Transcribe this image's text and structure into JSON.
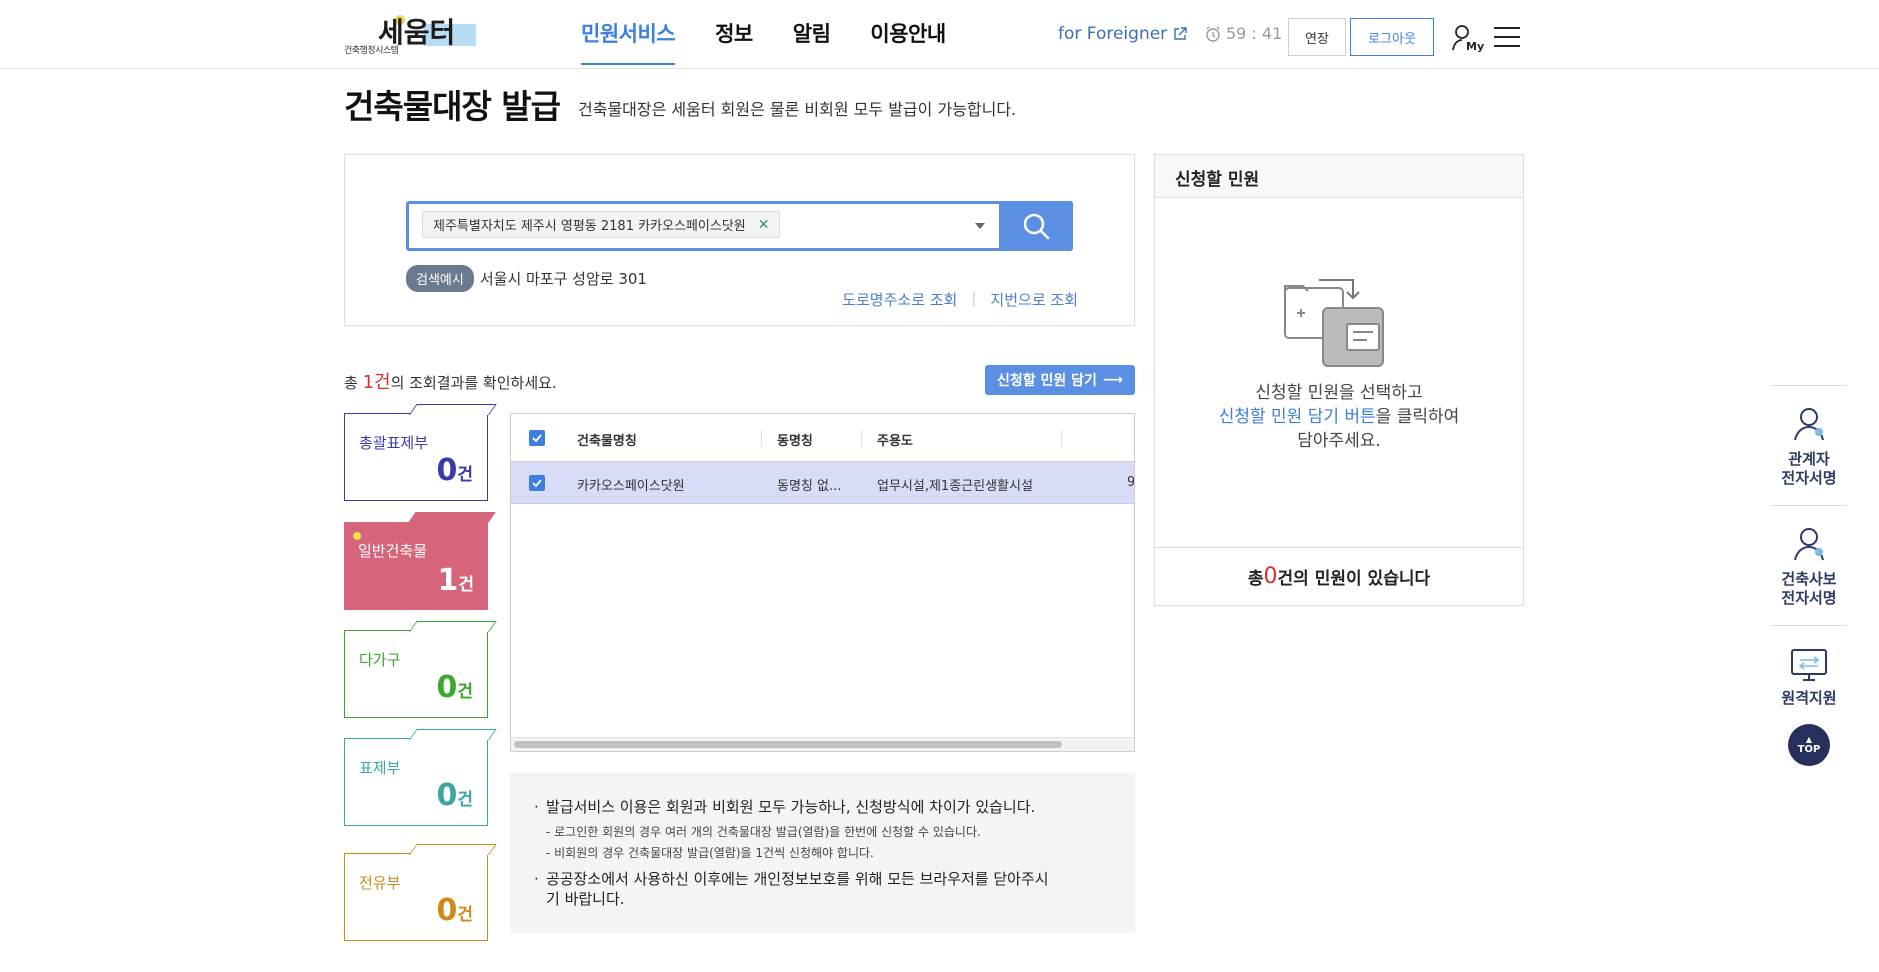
{
  "header": {
    "logo_sub": "건축행정시스템",
    "logo_text": "세움터",
    "nav": [
      {
        "label": "민원서비스",
        "active": true
      },
      {
        "label": "정보",
        "active": false
      },
      {
        "label": "알림",
        "active": false
      },
      {
        "label": "이용안내",
        "active": false
      }
    ],
    "foreigner": "for Foreigner",
    "timer": "59 : 41",
    "extend": "연장",
    "logout": "로그아웃",
    "my": "My"
  },
  "page": {
    "title": "건축물대장 발급",
    "desc": "건축물대장은 세움터 회원은 물론 비회원 모두 발급이 가능합니다."
  },
  "search": {
    "tag": "제주특별자치도 제주시 영평동 2181 카카오스페이스닷원",
    "example_badge": "검색예시",
    "example_text": "서울시 마포구 성암로 301",
    "link_road": "도로명주소로 조회",
    "link_lot": "지번으로 조회"
  },
  "result": {
    "prefix": "총 ",
    "count": "1건",
    "suffix": "의 조회결과를 확인하세요.",
    "add_button": "신청할 민원 담기"
  },
  "categories": [
    {
      "name": "총괄표제부",
      "count": "0",
      "unit": "건",
      "color": "#3b3aa8"
    },
    {
      "name": "일반건축물",
      "count": "1",
      "unit": "건",
      "color": "#d6647a"
    },
    {
      "name": "다가구",
      "count": "0",
      "unit": "건",
      "color": "#3aa82c"
    },
    {
      "name": "표제부",
      "count": "0",
      "unit": "건",
      "color": "#3aa8a0"
    },
    {
      "name": "전유부",
      "count": "0",
      "unit": "건",
      "color": "#d08a17"
    }
  ],
  "table": {
    "columns": [
      "건축물명칭",
      "동명칭",
      "주용도"
    ],
    "rows": [
      {
        "name": "카카오스페이스닷원",
        "dong": "동명칭 없...",
        "use": "업무시설,제1종근린생활시설",
        "extra": "9"
      }
    ]
  },
  "notice": {
    "item1": "발급서비스 이용은 회원과 비회원 모두 가능하나, 신청방식에 차이가 있습니다.",
    "sub1": "- 로그인한 회원의 경우 여러 개의 건축물대장 발급(열람)을 한번에 신청할 수 있습니다.",
    "sub2": "- 비회원의 경우 건축물대장 발급(열람)을 1건씩 신청해야 합니다.",
    "item2": "공공장소에서 사용하신 이후에는 개인정보보호를 위해 모든 브라우저를 닫아주시기 바랍니다."
  },
  "right_panel": {
    "title": "신청할 민원",
    "msg1": "신청할 민원을 선택하고",
    "msg2_hl": "신청할 민원 담기 버튼",
    "msg2_rest": "을 클릭하여",
    "msg3": "담아주세요.",
    "footer_prefix": "총 ",
    "footer_count": "0",
    "footer_suffix": "건의 민원이 있습니다"
  },
  "quick_menu": {
    "item1": "관계자\n전자서명",
    "item2": "건축사보\n전자서명",
    "item3": "원격지원",
    "top": "TOP"
  }
}
